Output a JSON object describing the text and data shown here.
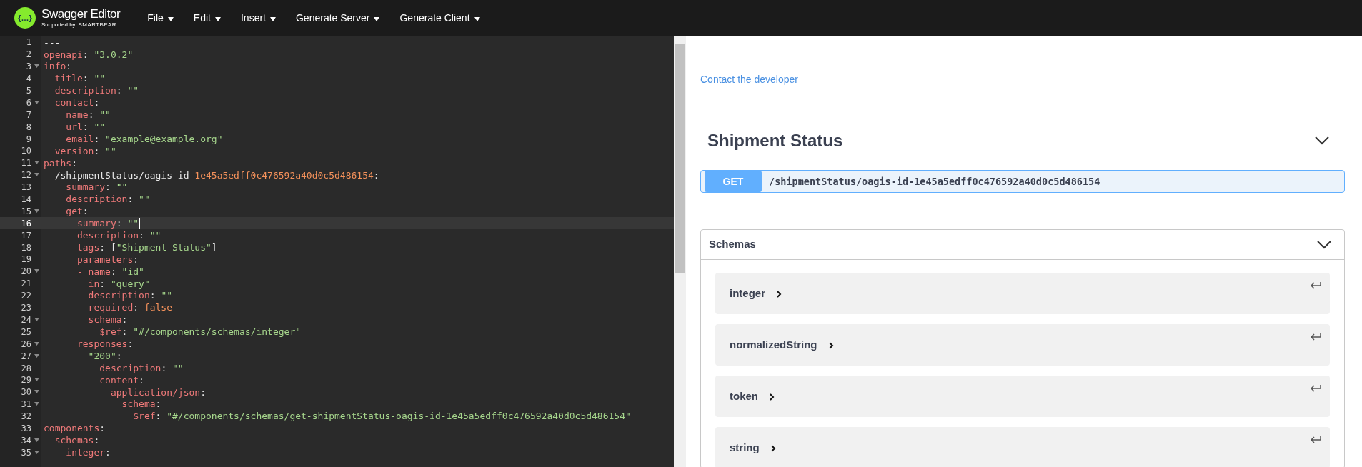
{
  "topbar": {
    "logo_mark": "{…}",
    "brand": "Swagger Editor",
    "supported_by": "Supported by",
    "vendor": "SMARTBEAR",
    "menu": [
      {
        "label": "File"
      },
      {
        "label": "Edit"
      },
      {
        "label": "Insert"
      },
      {
        "label": "Generate Server"
      },
      {
        "label": "Generate Client"
      }
    ]
  },
  "editor": {
    "lines": [
      {
        "n": "1",
        "fold": false,
        "active": false,
        "tokens": [
          {
            "kind": "plain",
            "text": "---"
          }
        ]
      },
      {
        "n": "2",
        "fold": false,
        "active": false,
        "tokens": [
          {
            "kind": "key",
            "text": "openapi"
          },
          {
            "kind": "plain",
            "text": ": "
          },
          {
            "kind": "string",
            "text": "\"3.0.2\""
          }
        ]
      },
      {
        "n": "3",
        "fold": true,
        "active": false,
        "tokens": [
          {
            "kind": "key",
            "text": "info"
          },
          {
            "kind": "plain",
            "text": ":"
          }
        ]
      },
      {
        "n": "4",
        "fold": false,
        "active": false,
        "tokens": [
          {
            "kind": "key",
            "text": "  title"
          },
          {
            "kind": "plain",
            "text": ": "
          },
          {
            "kind": "string",
            "text": "\"\""
          }
        ]
      },
      {
        "n": "5",
        "fold": false,
        "active": false,
        "tokens": [
          {
            "kind": "key",
            "text": "  description"
          },
          {
            "kind": "plain",
            "text": ": "
          },
          {
            "kind": "string",
            "text": "\"\""
          }
        ]
      },
      {
        "n": "6",
        "fold": true,
        "active": false,
        "tokens": [
          {
            "kind": "key",
            "text": "  contact"
          },
          {
            "kind": "plain",
            "text": ":"
          }
        ]
      },
      {
        "n": "7",
        "fold": false,
        "active": false,
        "tokens": [
          {
            "kind": "key",
            "text": "    name"
          },
          {
            "kind": "plain",
            "text": ": "
          },
          {
            "kind": "string",
            "text": "\"\""
          }
        ]
      },
      {
        "n": "8",
        "fold": false,
        "active": false,
        "tokens": [
          {
            "kind": "key",
            "text": "    url"
          },
          {
            "kind": "plain",
            "text": ": "
          },
          {
            "kind": "string",
            "text": "\"\""
          }
        ]
      },
      {
        "n": "9",
        "fold": false,
        "active": false,
        "tokens": [
          {
            "kind": "key",
            "text": "    email"
          },
          {
            "kind": "plain",
            "text": ": "
          },
          {
            "kind": "string",
            "text": "\"example@example.org\""
          }
        ]
      },
      {
        "n": "10",
        "fold": false,
        "active": false,
        "tokens": [
          {
            "kind": "key",
            "text": "  version"
          },
          {
            "kind": "plain",
            "text": ": "
          },
          {
            "kind": "string",
            "text": "\"\""
          }
        ]
      },
      {
        "n": "11",
        "fold": true,
        "active": false,
        "tokens": [
          {
            "kind": "key",
            "text": "paths"
          },
          {
            "kind": "plain",
            "text": ":"
          }
        ]
      },
      {
        "n": "12",
        "fold": true,
        "active": false,
        "tokens": [
          {
            "kind": "plain",
            "text": "  /shipmentStatus/oagis-id-"
          },
          {
            "kind": "value",
            "text": "1e45a5edff0c476592a40d0c5d486154"
          },
          {
            "kind": "plain",
            "text": ":"
          }
        ]
      },
      {
        "n": "13",
        "fold": false,
        "active": false,
        "tokens": [
          {
            "kind": "key",
            "text": "    summary"
          },
          {
            "kind": "plain",
            "text": ": "
          },
          {
            "kind": "string",
            "text": "\"\""
          }
        ]
      },
      {
        "n": "14",
        "fold": false,
        "active": false,
        "tokens": [
          {
            "kind": "key",
            "text": "    description"
          },
          {
            "kind": "plain",
            "text": ": "
          },
          {
            "kind": "string",
            "text": "\"\""
          }
        ]
      },
      {
        "n": "15",
        "fold": true,
        "active": false,
        "tokens": [
          {
            "kind": "key",
            "text": "    get"
          },
          {
            "kind": "plain",
            "text": ":"
          }
        ]
      },
      {
        "n": "16",
        "fold": false,
        "active": true,
        "tokens": [
          {
            "kind": "key",
            "text": "      summary"
          },
          {
            "kind": "plain",
            "text": ": "
          },
          {
            "kind": "string",
            "text": "\"\""
          }
        ]
      },
      {
        "n": "17",
        "fold": false,
        "active": false,
        "tokens": [
          {
            "kind": "key",
            "text": "      description"
          },
          {
            "kind": "plain",
            "text": ": "
          },
          {
            "kind": "string",
            "text": "\"\""
          }
        ]
      },
      {
        "n": "18",
        "fold": false,
        "active": false,
        "tokens": [
          {
            "kind": "key",
            "text": "      tags"
          },
          {
            "kind": "plain",
            "text": ": ["
          },
          {
            "kind": "string",
            "text": "\"Shipment Status\""
          },
          {
            "kind": "plain",
            "text": "]"
          }
        ]
      },
      {
        "n": "19",
        "fold": false,
        "active": false,
        "tokens": [
          {
            "kind": "key",
            "text": "      parameters"
          },
          {
            "kind": "plain",
            "text": ":"
          }
        ]
      },
      {
        "n": "20",
        "fold": true,
        "active": false,
        "tokens": [
          {
            "kind": "key",
            "text": "      - name"
          },
          {
            "kind": "plain",
            "text": ": "
          },
          {
            "kind": "string",
            "text": "\"id\""
          }
        ]
      },
      {
        "n": "21",
        "fold": false,
        "active": false,
        "tokens": [
          {
            "kind": "key",
            "text": "        in"
          },
          {
            "kind": "plain",
            "text": ": "
          },
          {
            "kind": "string",
            "text": "\"query\""
          }
        ]
      },
      {
        "n": "22",
        "fold": false,
        "active": false,
        "tokens": [
          {
            "kind": "key",
            "text": "        description"
          },
          {
            "kind": "plain",
            "text": ": "
          },
          {
            "kind": "string",
            "text": "\"\""
          }
        ]
      },
      {
        "n": "23",
        "fold": false,
        "active": false,
        "tokens": [
          {
            "kind": "key",
            "text": "        required"
          },
          {
            "kind": "plain",
            "text": ": "
          },
          {
            "kind": "value",
            "text": "false"
          }
        ]
      },
      {
        "n": "24",
        "fold": true,
        "active": false,
        "tokens": [
          {
            "kind": "key",
            "text": "        schema"
          },
          {
            "kind": "plain",
            "text": ":"
          }
        ]
      },
      {
        "n": "25",
        "fold": false,
        "active": false,
        "tokens": [
          {
            "kind": "key",
            "text": "          $ref"
          },
          {
            "kind": "plain",
            "text": ": "
          },
          {
            "kind": "string",
            "text": "\"#/components/schemas/integer\""
          }
        ]
      },
      {
        "n": "26",
        "fold": true,
        "active": false,
        "tokens": [
          {
            "kind": "key",
            "text": "      responses"
          },
          {
            "kind": "plain",
            "text": ":"
          }
        ]
      },
      {
        "n": "27",
        "fold": true,
        "active": false,
        "tokens": [
          {
            "kind": "string",
            "text": "        \"200\""
          },
          {
            "kind": "plain",
            "text": ":"
          }
        ]
      },
      {
        "n": "28",
        "fold": false,
        "active": false,
        "tokens": [
          {
            "kind": "key",
            "text": "          description"
          },
          {
            "kind": "plain",
            "text": ": "
          },
          {
            "kind": "string",
            "text": "\"\""
          }
        ]
      },
      {
        "n": "29",
        "fold": true,
        "active": false,
        "tokens": [
          {
            "kind": "key",
            "text": "          content"
          },
          {
            "kind": "plain",
            "text": ":"
          }
        ]
      },
      {
        "n": "30",
        "fold": true,
        "active": false,
        "tokens": [
          {
            "kind": "key",
            "text": "            application/json"
          },
          {
            "kind": "plain",
            "text": ":"
          }
        ]
      },
      {
        "n": "31",
        "fold": true,
        "active": false,
        "tokens": [
          {
            "kind": "key",
            "text": "              schema"
          },
          {
            "kind": "plain",
            "text": ":"
          }
        ]
      },
      {
        "n": "32",
        "fold": false,
        "active": false,
        "tokens": [
          {
            "kind": "key",
            "text": "                $ref"
          },
          {
            "kind": "plain",
            "text": ": "
          },
          {
            "kind": "string",
            "text": "\"#/components/schemas/get-shipmentStatus-oagis-id-1e45a5edff0c476592a40d0c5d486154\""
          }
        ]
      },
      {
        "n": "33",
        "fold": false,
        "active": false,
        "tokens": [
          {
            "kind": "key",
            "text": "components"
          },
          {
            "kind": "plain",
            "text": ":"
          }
        ]
      },
      {
        "n": "34",
        "fold": true,
        "active": false,
        "tokens": [
          {
            "kind": "key",
            "text": "  schemas"
          },
          {
            "kind": "plain",
            "text": ":"
          }
        ]
      },
      {
        "n": "35",
        "fold": true,
        "active": false,
        "tokens": [
          {
            "kind": "key",
            "text": "    integer"
          },
          {
            "kind": "plain",
            "text": ":"
          }
        ]
      }
    ]
  },
  "preview": {
    "contact_link": "Contact the developer",
    "tag": {
      "title": "Shipment Status",
      "expanded": true,
      "operations": [
        {
          "method": "GET",
          "path": "/shipmentStatus/oagis-id-1e45a5edff0c476592a40d0c5d486154"
        }
      ]
    },
    "schemas": {
      "title": "Schemas",
      "expanded": true,
      "items": [
        {
          "name": "integer",
          "expanded": false
        },
        {
          "name": "normalizedString",
          "expanded": false
        },
        {
          "name": "token",
          "expanded": false
        },
        {
          "name": "string",
          "expanded": false
        }
      ]
    }
  }
}
